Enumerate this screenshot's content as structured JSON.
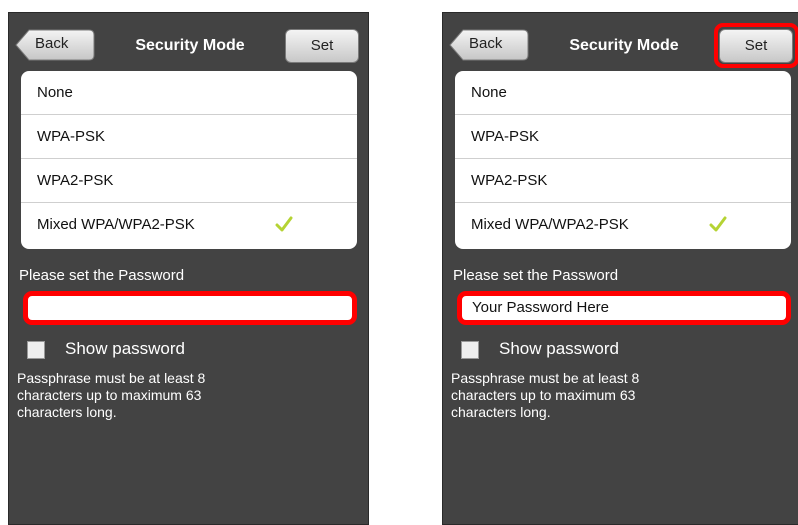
{
  "screens": [
    {
      "nav": {
        "back_label": "Back",
        "title": "Security Mode",
        "set_label": "Set"
      },
      "modes": [
        {
          "label": "None",
          "selected": false
        },
        {
          "label": "WPA-PSK",
          "selected": false
        },
        {
          "label": "WPA2-PSK",
          "selected": false
        },
        {
          "label": "Mixed WPA/WPA2-PSK",
          "selected": true
        }
      ],
      "password": {
        "label": "Please set the Password",
        "value": ""
      },
      "show_password_label": "Show password",
      "hint": "Passphrase must be at least 8 characters up to maximum 63 characters long."
    },
    {
      "nav": {
        "back_label": "Back",
        "title": "Security Mode",
        "set_label": "Set"
      },
      "modes": [
        {
          "label": "None",
          "selected": false
        },
        {
          "label": "WPA-PSK",
          "selected": false
        },
        {
          "label": "WPA2-PSK",
          "selected": false
        },
        {
          "label": "Mixed WPA/WPA2-PSK",
          "selected": true
        }
      ],
      "password": {
        "label": "Please set the Password",
        "value": "Your Password Here"
      },
      "show_password_label": "Show password",
      "hint": "Passphrase must be at least 8 characters up to maximum 63 characters long."
    }
  ],
  "colors": {
    "screen_bg": "#434343",
    "highlight": "#ff0000",
    "check": "#b5d334"
  }
}
